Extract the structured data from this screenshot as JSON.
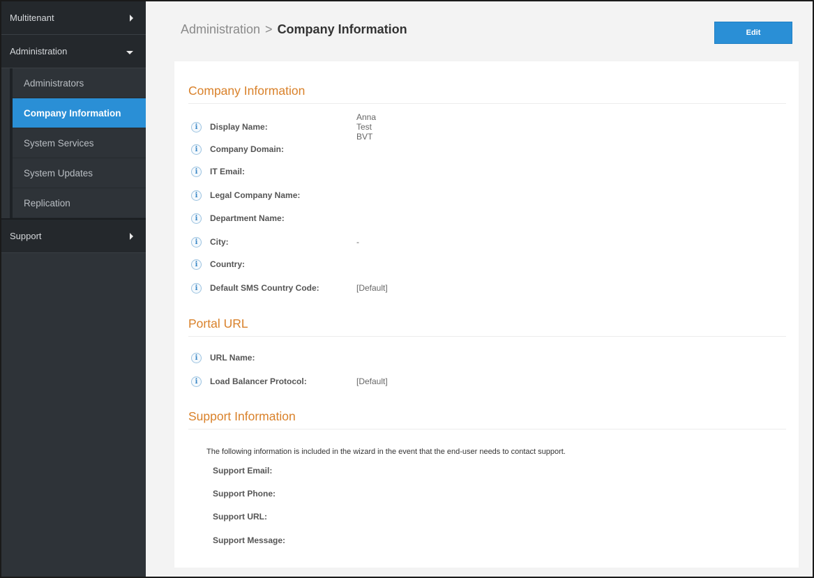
{
  "sidebar": {
    "top_item": "Multitenant",
    "admin_item": "Administration",
    "sub_items": [
      {
        "label": "Administrators"
      },
      {
        "label": "Company Information"
      },
      {
        "label": "System Services"
      },
      {
        "label": "System Updates"
      },
      {
        "label": "Replication"
      }
    ],
    "support_item": "Support"
  },
  "header": {
    "breadcrumb_parent": "Administration",
    "breadcrumb_separator": ">",
    "breadcrumb_current": "Company Information",
    "edit_label": "Edit"
  },
  "company_info": {
    "title": "Company Information",
    "fields": [
      {
        "label": "Display Name:",
        "value": "Anna Test BVT"
      },
      {
        "label": "Company Domain:",
        "value": ""
      },
      {
        "label": "IT Email:",
        "value": ""
      },
      {
        "label": "Legal Company Name:",
        "value": ""
      },
      {
        "label": "Department Name:",
        "value": ""
      },
      {
        "label": "City:",
        "value": "-"
      },
      {
        "label": "Country:",
        "value": ""
      },
      {
        "label": "Default SMS Country Code:",
        "value": "[Default]"
      }
    ]
  },
  "portal_url": {
    "title": "Portal URL",
    "fields": [
      {
        "label": "URL Name:",
        "value": ""
      },
      {
        "label": "Load Balancer Protocol:",
        "value": "[Default]"
      }
    ]
  },
  "support_info": {
    "title": "Support Information",
    "description": "The following information is included in the wizard in the event that the end-user needs to contact support.",
    "fields": [
      {
        "label": "Support Email:"
      },
      {
        "label": "Support Phone:"
      },
      {
        "label": "Support URL:"
      },
      {
        "label": "Support Message:"
      }
    ]
  },
  "icons": {
    "info": "info-icon",
    "caret_right": "caret-right-icon",
    "caret_down": "caret-down-icon"
  },
  "colors": {
    "accent_blue": "#2a8fd6",
    "section_orange": "#d9812a",
    "sidebar_bg": "#2e3338"
  }
}
